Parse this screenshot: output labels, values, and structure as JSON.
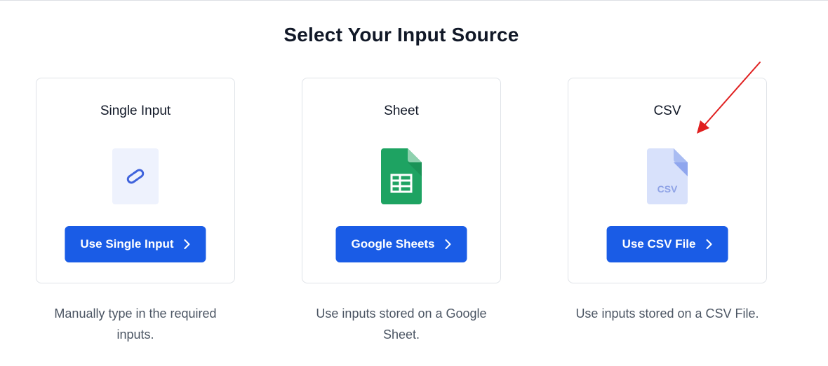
{
  "page": {
    "title": "Select Your Input Source"
  },
  "cards": [
    {
      "title": "Single Input",
      "button_label": "Use Single Input",
      "description": "Manually type in the required inputs.",
      "icon": "link-icon"
    },
    {
      "title": "Sheet",
      "button_label": "Google Sheets",
      "description": "Use inputs stored on a Google Sheet.",
      "icon": "google-sheets-icon"
    },
    {
      "title": "CSV",
      "button_label": "Use CSV File",
      "description": "Use inputs stored on a CSV File.",
      "icon": "csv-file-icon",
      "icon_text": "CSV"
    }
  ],
  "colors": {
    "button": "#1a5ce6",
    "annotation_arrow": "#e02020"
  }
}
